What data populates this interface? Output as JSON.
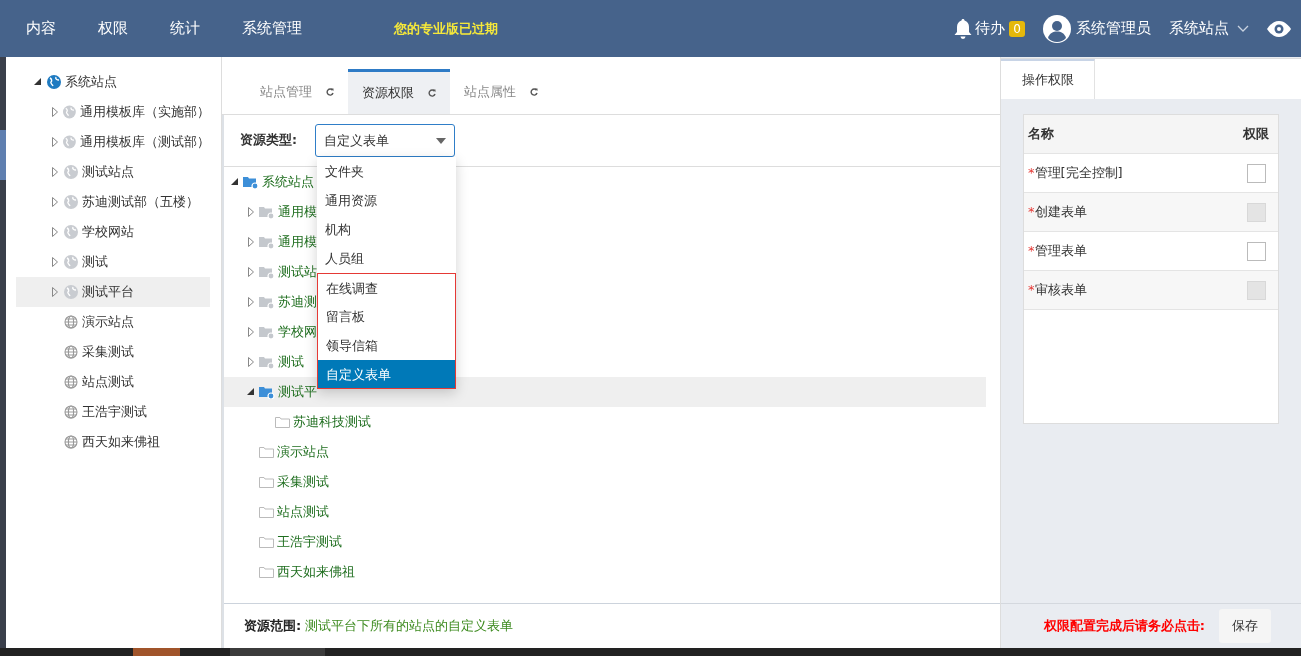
{
  "header": {
    "nav": [
      {
        "label": "内容"
      },
      {
        "label": "权限"
      },
      {
        "label": "统计"
      },
      {
        "label": "系统管理"
      }
    ],
    "notice": "您的专业版已过期",
    "todo": {
      "label": "待办",
      "count": "0"
    },
    "user": "系统管理员",
    "site_switch": "系统站点"
  },
  "sidebar": {
    "tree": [
      {
        "label": "系统站点",
        "kind": "site",
        "expanded": true,
        "selected": false,
        "children": [
          {
            "label": "通用模板库（实施部）",
            "kind": "site",
            "expanded": false,
            "selected": false
          },
          {
            "label": "通用模板库（测试部）",
            "kind": "site",
            "expanded": false,
            "selected": false
          },
          {
            "label": "测试站点",
            "kind": "site",
            "expanded": false,
            "selected": false
          },
          {
            "label": "苏迪测试部（五楼）",
            "kind": "site",
            "expanded": false,
            "selected": false
          },
          {
            "label": "学校网站",
            "kind": "site",
            "expanded": false,
            "selected": false
          },
          {
            "label": "测试",
            "kind": "site",
            "expanded": false,
            "selected": false
          },
          {
            "label": "测试平台",
            "kind": "site",
            "expanded": false,
            "selected": true
          },
          {
            "label": "演示站点",
            "kind": "leaf",
            "selected": false
          },
          {
            "label": "采集测试",
            "kind": "leaf",
            "selected": false
          },
          {
            "label": "站点测试",
            "kind": "leaf",
            "selected": false
          },
          {
            "label": "王浩宇测试",
            "kind": "leaf",
            "selected": false
          },
          {
            "label": "西天如来佛祖",
            "kind": "leaf",
            "selected": false
          }
        ]
      }
    ]
  },
  "tabs": [
    {
      "label": "站点管理",
      "selected": false
    },
    {
      "label": "资源权限",
      "selected": true
    },
    {
      "label": "站点属性",
      "selected": false
    }
  ],
  "resource_type": {
    "label": "资源类型:",
    "value": "自定义表单",
    "expanded": true,
    "options": [
      {
        "label": "文件夹",
        "selected": false,
        "marked": false
      },
      {
        "label": "通用资源",
        "selected": false,
        "marked": false
      },
      {
        "label": "机构",
        "selected": false,
        "marked": false
      },
      {
        "label": "人员组",
        "selected": false,
        "marked": false
      },
      {
        "label": "在线调查",
        "selected": false,
        "marked": true
      },
      {
        "label": "留言板",
        "selected": false,
        "marked": true
      },
      {
        "label": "领导信箱",
        "selected": false,
        "marked": true
      },
      {
        "label": "自定义表单",
        "selected": true,
        "marked": true
      }
    ]
  },
  "resource_tree": [
    {
      "label": "系统站点",
      "kind": "site",
      "expanded": true,
      "selected": false,
      "children": [
        {
          "label": "通用模",
          "kind": "site",
          "expanded": false,
          "selected": false
        },
        {
          "label": "通用模",
          "kind": "site",
          "expanded": false,
          "selected": false
        },
        {
          "label": "测试站",
          "kind": "site",
          "expanded": false,
          "selected": false
        },
        {
          "label": "苏迪测",
          "kind": "site",
          "expanded": false,
          "selected": false
        },
        {
          "label": "学校网",
          "kind": "site",
          "expanded": false,
          "selected": false
        },
        {
          "label": "测试",
          "kind": "site",
          "expanded": false,
          "selected": false
        },
        {
          "label": "测试平",
          "kind": "site",
          "expanded": true,
          "selected": true,
          "children": [
            {
              "label": "苏迪科技测试",
              "kind": "folder",
              "selected": false
            }
          ]
        },
        {
          "label": "演示站点",
          "kind": "folder",
          "selected": false
        },
        {
          "label": "采集测试",
          "kind": "folder",
          "selected": false
        },
        {
          "label": "站点测试",
          "kind": "folder",
          "selected": false
        },
        {
          "label": "王浩宇测试",
          "kind": "folder",
          "selected": false
        },
        {
          "label": "西天如来佛祖",
          "kind": "folder",
          "selected": false
        }
      ]
    }
  ],
  "scope": {
    "label": "资源范围:",
    "value": "测试平台下所有的站点的自定义表单"
  },
  "permissions": {
    "tab": "操作权限",
    "columns": [
      "名称",
      "权限"
    ],
    "rows": [
      {
        "mark": "*",
        "name": "管理[完全控制]",
        "checked": false,
        "disabled": false
      },
      {
        "mark": "*",
        "name": "创建表单",
        "checked": false,
        "disabled": true
      },
      {
        "mark": "*",
        "name": "管理表单",
        "checked": false,
        "disabled": false
      },
      {
        "mark": "*",
        "name": "审核表单",
        "checked": false,
        "disabled": true
      }
    ]
  },
  "save_hint": "权限配置完成后请务必点击:",
  "save_button": "保存"
}
